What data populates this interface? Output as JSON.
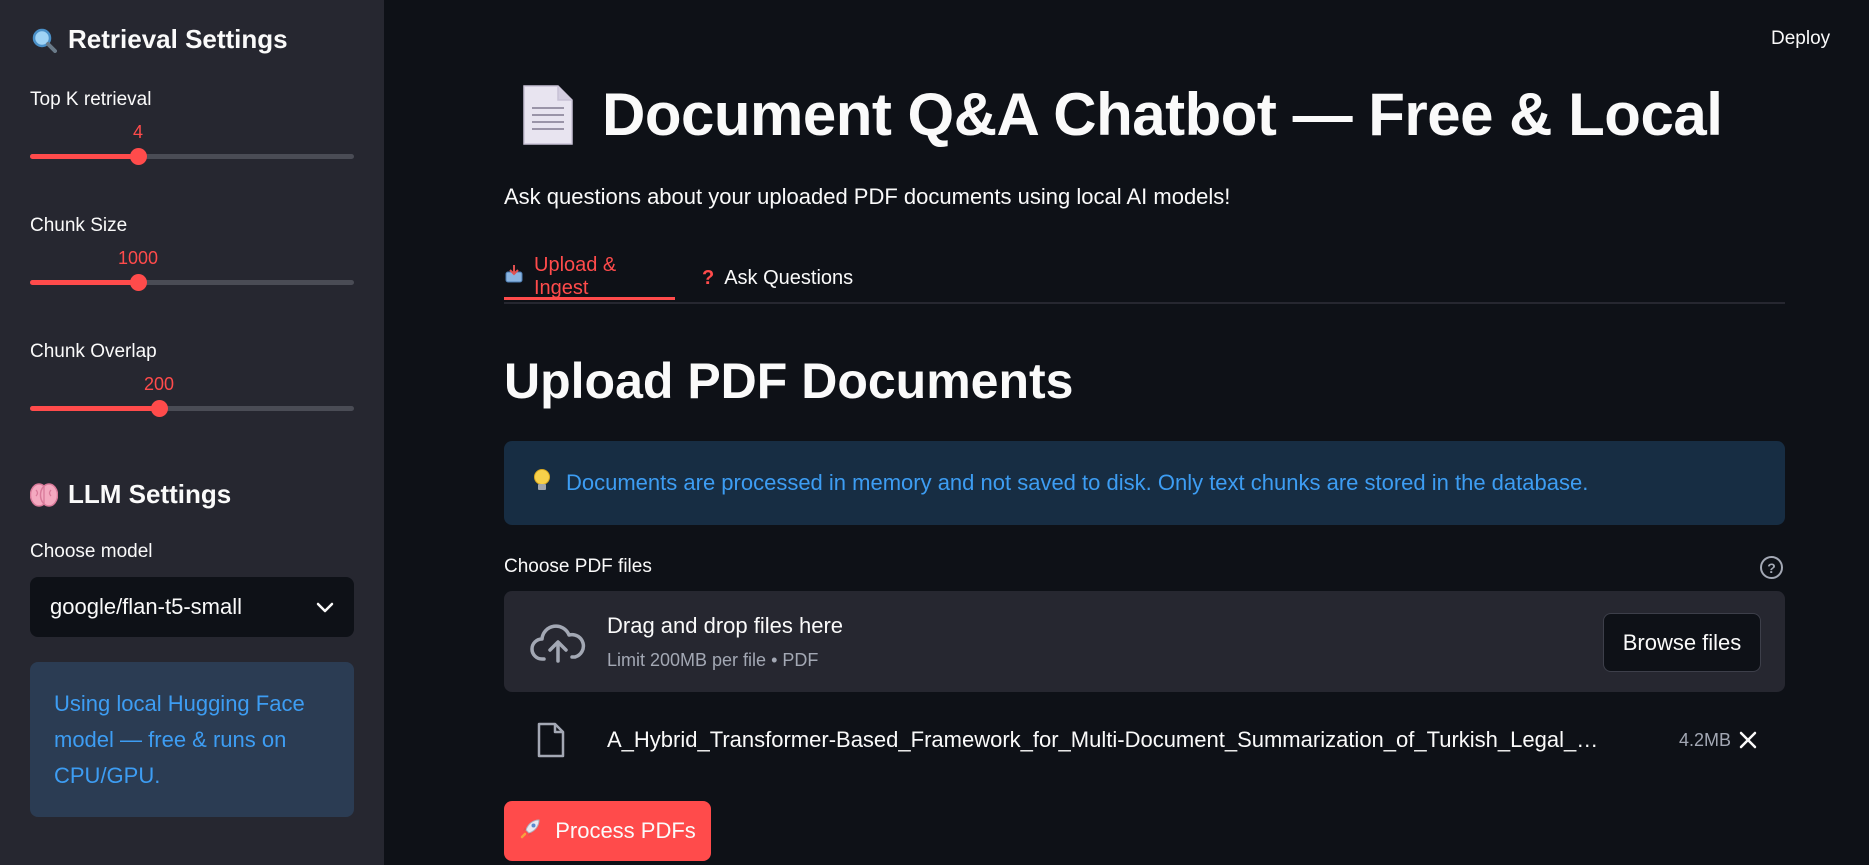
{
  "sidebar": {
    "retrieval_heading": "Retrieval Settings",
    "sliders": [
      {
        "label": "Top K retrieval",
        "value": "4",
        "fraction": 0.33
      },
      {
        "label": "Chunk Size",
        "value": "1000",
        "fraction": 0.33
      },
      {
        "label": "Chunk Overlap",
        "value": "200",
        "fraction": 0.4
      }
    ],
    "llm_heading": "LLM Settings",
    "model_label": "Choose model",
    "model_value": "google/flan-t5-small",
    "info": "Using local Hugging Face model — free & runs on CPU/GPU."
  },
  "header": {
    "deploy": "Deploy"
  },
  "main": {
    "title": "Document Q&A Chatbot — Free & Local",
    "subtitle": "Ask questions about your uploaded PDF documents using local AI models!",
    "tabs": [
      {
        "label": "Upload & Ingest",
        "active": true
      },
      {
        "label": "Ask Questions",
        "active": false
      }
    ],
    "section_title": "Upload PDF Documents",
    "info": "Documents are processed in memory and not saved to disk. Only text chunks are stored in the database.",
    "uploader": {
      "label": "Choose PDF files",
      "help": "?",
      "drop_text": "Drag and drop files here",
      "limit_text": "Limit 200MB per file • PDF",
      "browse_label": "Browse files"
    },
    "file": {
      "name": "A_Hybrid_Transformer-Based_Framework_for_Multi-Document_Summarization_of_Turkish_Legal_Do...",
      "size": "4.2MB"
    },
    "process_button": "Process PDFs"
  },
  "colors": {
    "accent": "#ff4b4b",
    "info_text": "#3d9df3",
    "sidebar_bg": "#262730",
    "main_bg": "#0e1117"
  }
}
